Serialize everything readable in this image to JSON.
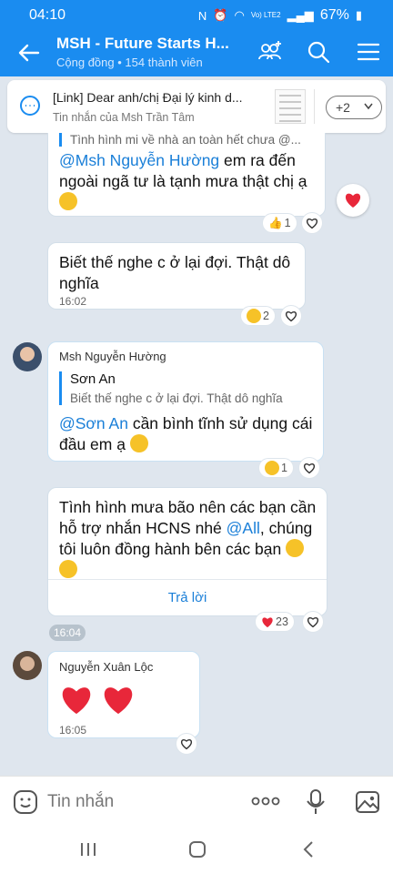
{
  "status": {
    "time": "04:10",
    "network": "Vo) LTE2",
    "battery": "67%"
  },
  "header": {
    "title": "MSH - Future Starts H...",
    "subtitle": "Cộng đồng • 154 thành viên"
  },
  "pinned": {
    "title": "[Link] Dear anh/chị Đại lý kinh d...",
    "subtitle": "Tin nhắn của Msh Trần Tâm",
    "more": "+2"
  },
  "messages": [
    {
      "quote_snippet": "Tình hình mi về nhà an toàn hết chưa @...",
      "mention": "@Msh Nguyễn Hường",
      "text": " em ra đến ngoài ngã tư là tạnh mưa thật chị ạ",
      "reaction_count": "1"
    },
    {
      "text": "Biết thế nghe c ở lại đợi. Thật dô nghĩa",
      "time": "16:02",
      "reaction_count": "2"
    },
    {
      "sender": "Msh Nguyễn Hường",
      "quote_name": "Sơn An",
      "quote_text": "Biết thế nghe c ở lại đợi. Thật dô nghĩa",
      "mention": "@Sơn An",
      "text": " cần bình tĩnh sử dụng cái đầu em ạ",
      "reaction_count": "1"
    },
    {
      "text_before": "Tình hình mưa bão nên các bạn cần hỗ trợ nhắn HCNS nhé ",
      "mention": "@All",
      "text_after": ", chúng tôi luôn đồng hành bên các bạn",
      "reply_label": "Trả lời",
      "reaction_count": "23"
    },
    {
      "sender": "Nguyễn Xuân Lộc",
      "time": "16:05"
    }
  ],
  "time_divider": "16:04",
  "composer": {
    "placeholder": "Tin nhắn"
  },
  "colors": {
    "header": "#1a8cf0",
    "mention": "#1a7fd8",
    "heart": "#e8273a"
  }
}
